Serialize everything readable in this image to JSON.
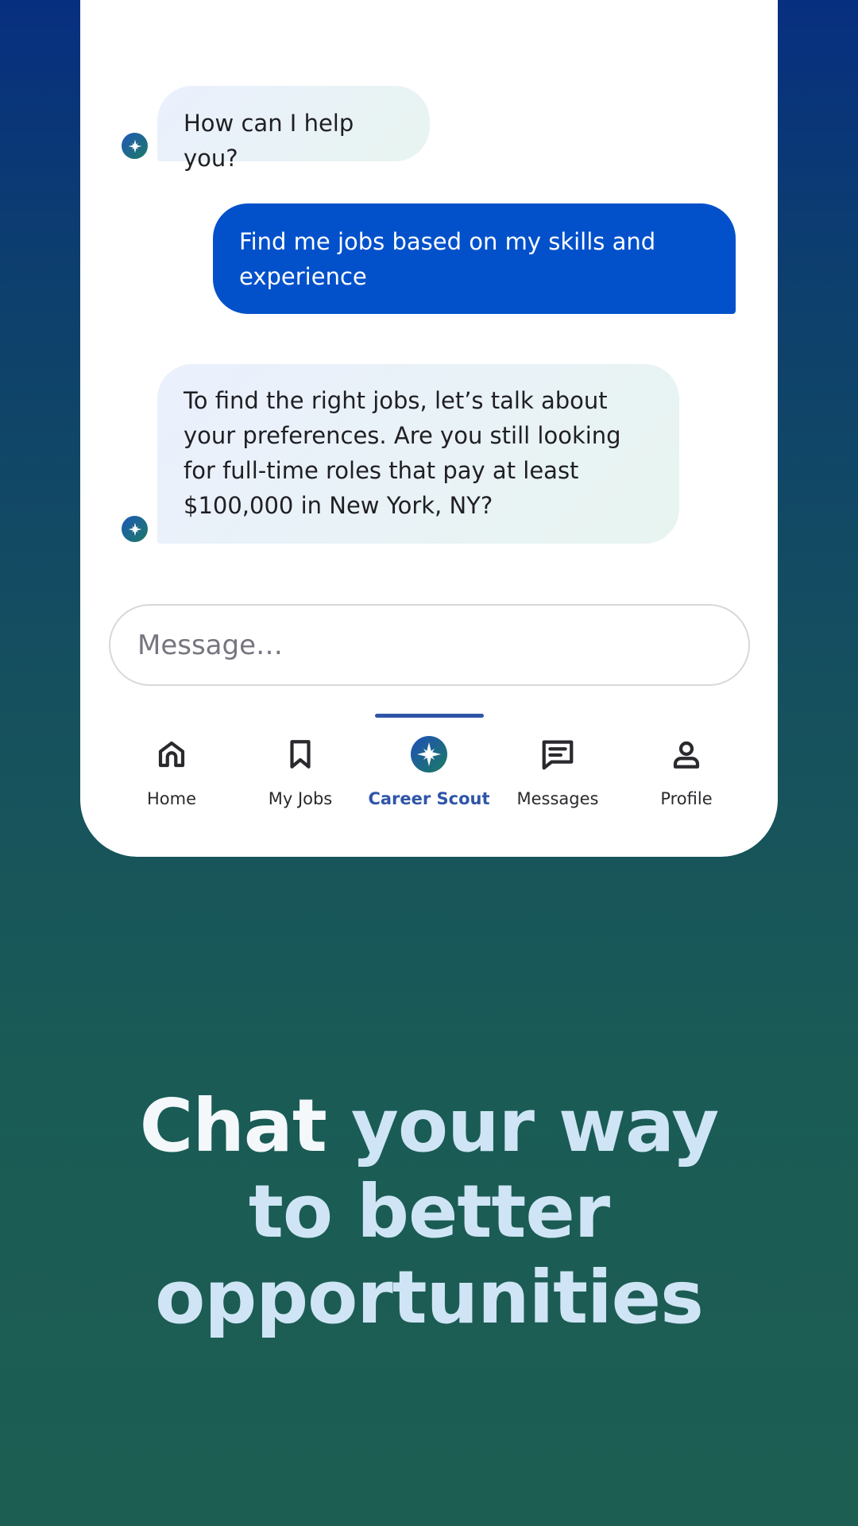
{
  "chat": {
    "messages": [
      {
        "sender": "bot",
        "text": "How can I help you?"
      },
      {
        "sender": "user",
        "text": "Find me jobs based on my skills and experience"
      },
      {
        "sender": "bot",
        "text": "To find the right jobs, let’s talk about your preferences. Are you still looking for full-time roles that pay at least $100,000 in New York, NY?"
      }
    ],
    "input": {
      "placeholder": "Message…",
      "value": ""
    }
  },
  "nav": {
    "items": [
      {
        "label": "Home",
        "icon": "home-icon",
        "active": false
      },
      {
        "label": "My Jobs",
        "icon": "bookmark-icon",
        "active": false
      },
      {
        "label": "Career Scout",
        "icon": "compass-star-icon",
        "active": true
      },
      {
        "label": "Messages",
        "icon": "message-icon",
        "active": false
      },
      {
        "label": "Profile",
        "icon": "person-icon",
        "active": false
      }
    ]
  },
  "tagline": {
    "line1_a": "Chat",
    "line1_b": "your way",
    "line2": "to better",
    "line3": "opportunities"
  },
  "colors": {
    "accent": "#2f55a8",
    "user_bubble": "#0251cb",
    "background_top": "#072f80",
    "background_bottom": "#1d5e52"
  }
}
